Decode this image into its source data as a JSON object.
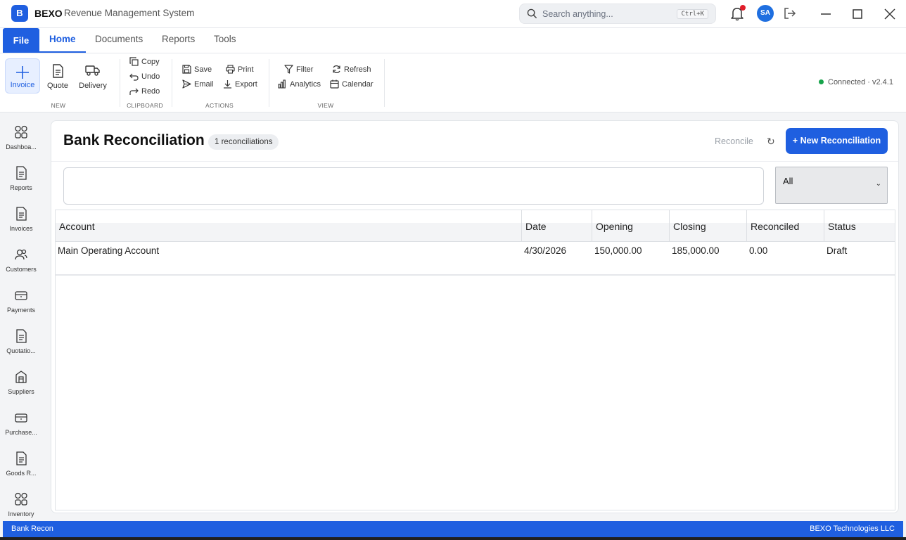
{
  "titlebar": {
    "logo_letter": "B",
    "brand": "BEXO",
    "subtitle": "Revenue Management System",
    "search_placeholder": "Search anything...",
    "search_shortcut": "Ctrl+K",
    "avatar_initials": "SA"
  },
  "menu": {
    "file": "File",
    "tabs": [
      "Home",
      "Documents",
      "Reports",
      "Tools"
    ],
    "active_tab": "Home"
  },
  "ribbon": {
    "groups": {
      "new": "NEW",
      "clipboard": "CLIPBOARD",
      "actions": "ACTIONS",
      "view": "VIEW"
    },
    "new_buttons": [
      "Invoice",
      "Quote",
      "Delivery"
    ],
    "clipboard_buttons": [
      "Copy",
      "Undo",
      "Redo"
    ],
    "actions_buttons": [
      "Save",
      "Print",
      "Email",
      "Export"
    ],
    "view_buttons": [
      "Filter",
      "Refresh",
      "Analytics",
      "Calendar"
    ],
    "connection_status": "Connected",
    "version": "v2.4.1"
  },
  "sidebar": {
    "items": [
      "Dashboa...",
      "Reports",
      "Invoices",
      "Customers",
      "Payments",
      "Quotatio...",
      "Suppliers",
      "Purchase...",
      "Goods R...",
      "Inventory"
    ]
  },
  "page": {
    "title": "Bank Reconciliation",
    "count_badge": "1 reconciliations",
    "reconcile_label": "Reconcile",
    "refresh_symbol": "↻",
    "new_button": "+ New Reconciliation",
    "search_value": "",
    "filter_value": "All"
  },
  "table": {
    "columns": [
      "Account",
      "Date",
      "Opening",
      "Closing",
      "Reconciled",
      "Status"
    ],
    "rows": [
      {
        "account": "Main Operating Account",
        "date": "4/30/2026",
        "opening": "150,000.00",
        "closing": "185,000.00",
        "reconciled": "0.00",
        "status": "Draft"
      }
    ]
  },
  "statusbar": {
    "left": "Bank Recon",
    "right": "BEXO Technologies LLC"
  },
  "colors": {
    "accent": "#1f5fe0",
    "connected": "#16a34a",
    "notification": "#e11d2a"
  }
}
